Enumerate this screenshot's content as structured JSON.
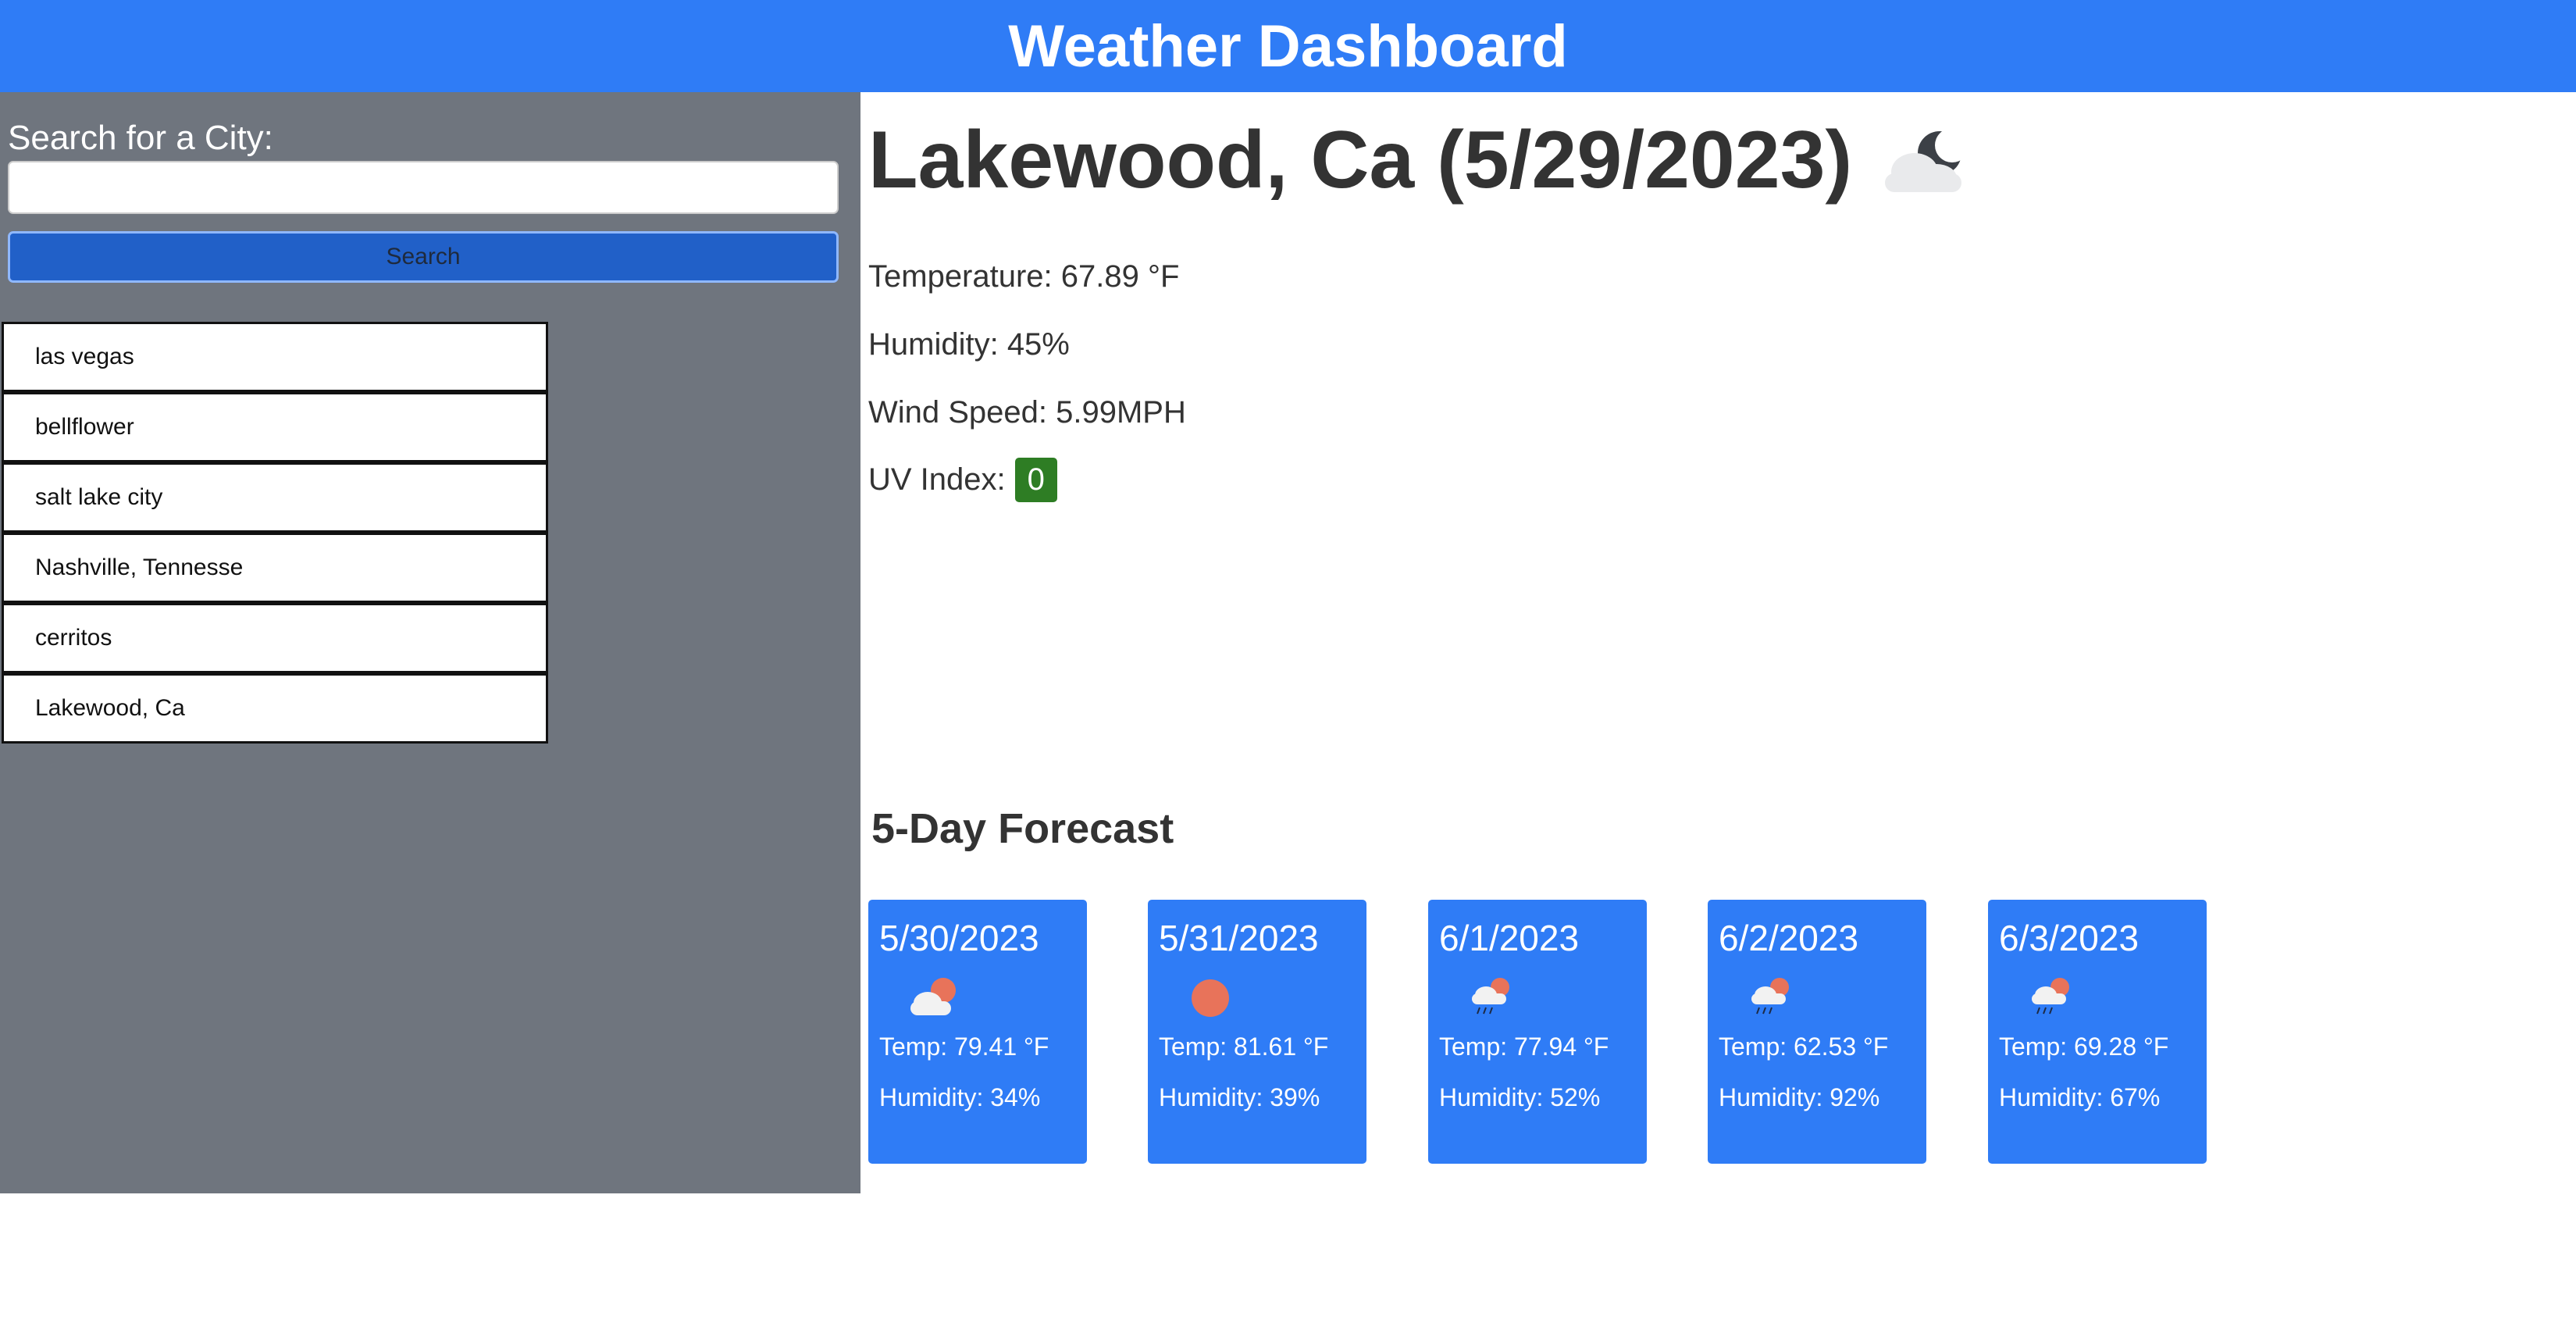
{
  "header": {
    "title": "Weather Dashboard"
  },
  "sidebar": {
    "search_label": "Search for a City:",
    "search_value": "",
    "search_placeholder": "",
    "search_button": "Search",
    "history": [
      "las vegas",
      "bellflower",
      "salt lake city",
      "Nashville, Tennesse",
      "cerritos",
      "Lakewood, Ca"
    ]
  },
  "current": {
    "title": "Lakewood, Ca (5/29/2023)",
    "icon": "cloudy-night-icon",
    "temperature": "Temperature: 67.89 °F",
    "humidity": "Humidity: 45%",
    "wind": "Wind Speed: 5.99MPH",
    "uv_label": "UV Index:",
    "uv_value": "0",
    "uv_color": "#2e7d24"
  },
  "forecast": {
    "title": "5-Day Forecast",
    "days": [
      {
        "date": "5/30/2023",
        "icon": "partly-cloudy-icon",
        "temp": "Temp: 79.41 °F",
        "humidity": "Humidity: 34%"
      },
      {
        "date": "5/31/2023",
        "icon": "sun-icon",
        "temp": "Temp: 81.61 °F",
        "humidity": "Humidity: 39%"
      },
      {
        "date": "6/1/2023",
        "icon": "sun-rain-icon",
        "temp": "Temp: 77.94 °F",
        "humidity": "Humidity: 52%"
      },
      {
        "date": "6/2/2023",
        "icon": "sun-rain-icon",
        "temp": "Temp: 62.53 °F",
        "humidity": "Humidity: 92%"
      },
      {
        "date": "6/3/2023",
        "icon": "sun-rain-icon",
        "temp": "Temp: 69.28 °F",
        "humidity": "Humidity: 67%"
      }
    ]
  },
  "colors": {
    "header": "#2f7cf6",
    "sidebar": "#6f757e",
    "search_button": "#2160c8",
    "card": "#2f7cf6"
  }
}
